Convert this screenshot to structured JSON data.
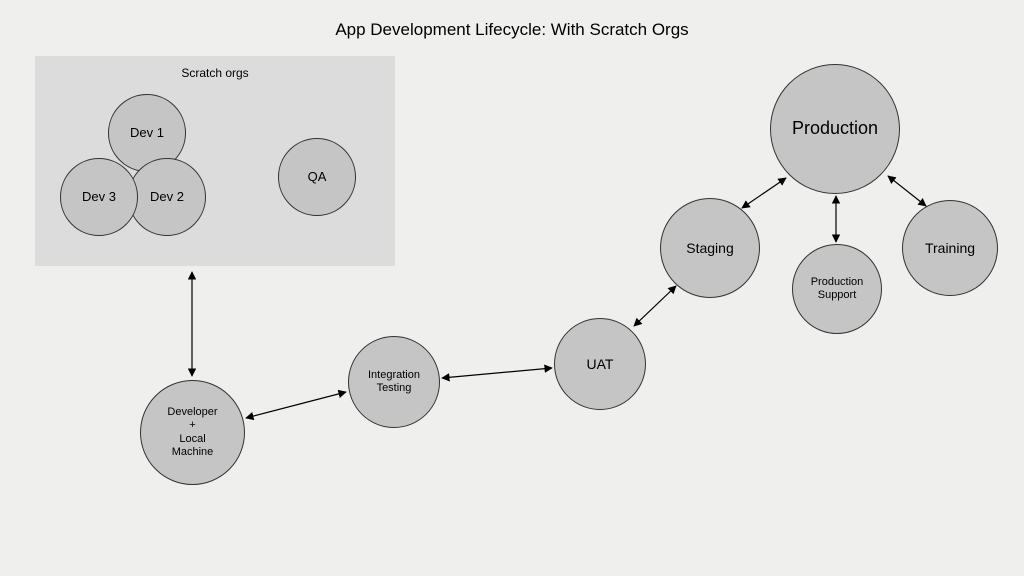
{
  "title": "App Development Lifecycle: With Scratch Orgs",
  "scratch_box": {
    "label": "Scratch orgs"
  },
  "nodes": {
    "dev1": "Dev 1",
    "dev2": "Dev 2",
    "dev3": "Dev 3",
    "qa": "QA",
    "developer": "Developer\n+\nLocal\nMachine",
    "integration": "Integration\nTesting",
    "uat": "UAT",
    "staging": "Staging",
    "production": "Production",
    "prod_support": "Production\nSupport",
    "training": "Training"
  },
  "chart_data": {
    "type": "diagram",
    "title": "App Development Lifecycle: With Scratch Orgs",
    "groups": [
      {
        "id": "scratch_orgs",
        "label": "Scratch orgs",
        "members": [
          "dev1",
          "dev2",
          "dev3",
          "qa"
        ]
      }
    ],
    "nodes": [
      {
        "id": "dev1",
        "label": "Dev 1"
      },
      {
        "id": "dev2",
        "label": "Dev 2"
      },
      {
        "id": "dev3",
        "label": "Dev 3"
      },
      {
        "id": "qa",
        "label": "QA"
      },
      {
        "id": "developer",
        "label": "Developer + Local Machine"
      },
      {
        "id": "integration",
        "label": "Integration Testing"
      },
      {
        "id": "uat",
        "label": "UAT"
      },
      {
        "id": "staging",
        "label": "Staging"
      },
      {
        "id": "production",
        "label": "Production"
      },
      {
        "id": "prod_support",
        "label": "Production Support"
      },
      {
        "id": "training",
        "label": "Training"
      }
    ],
    "edges": [
      {
        "from": "scratch_orgs",
        "to": "developer",
        "bidirectional": true
      },
      {
        "from": "developer",
        "to": "integration",
        "bidirectional": true
      },
      {
        "from": "integration",
        "to": "uat",
        "bidirectional": true
      },
      {
        "from": "uat",
        "to": "staging",
        "bidirectional": true
      },
      {
        "from": "staging",
        "to": "production",
        "bidirectional": true
      },
      {
        "from": "production",
        "to": "prod_support",
        "bidirectional": true
      },
      {
        "from": "production",
        "to": "training",
        "bidirectional": true
      }
    ]
  }
}
